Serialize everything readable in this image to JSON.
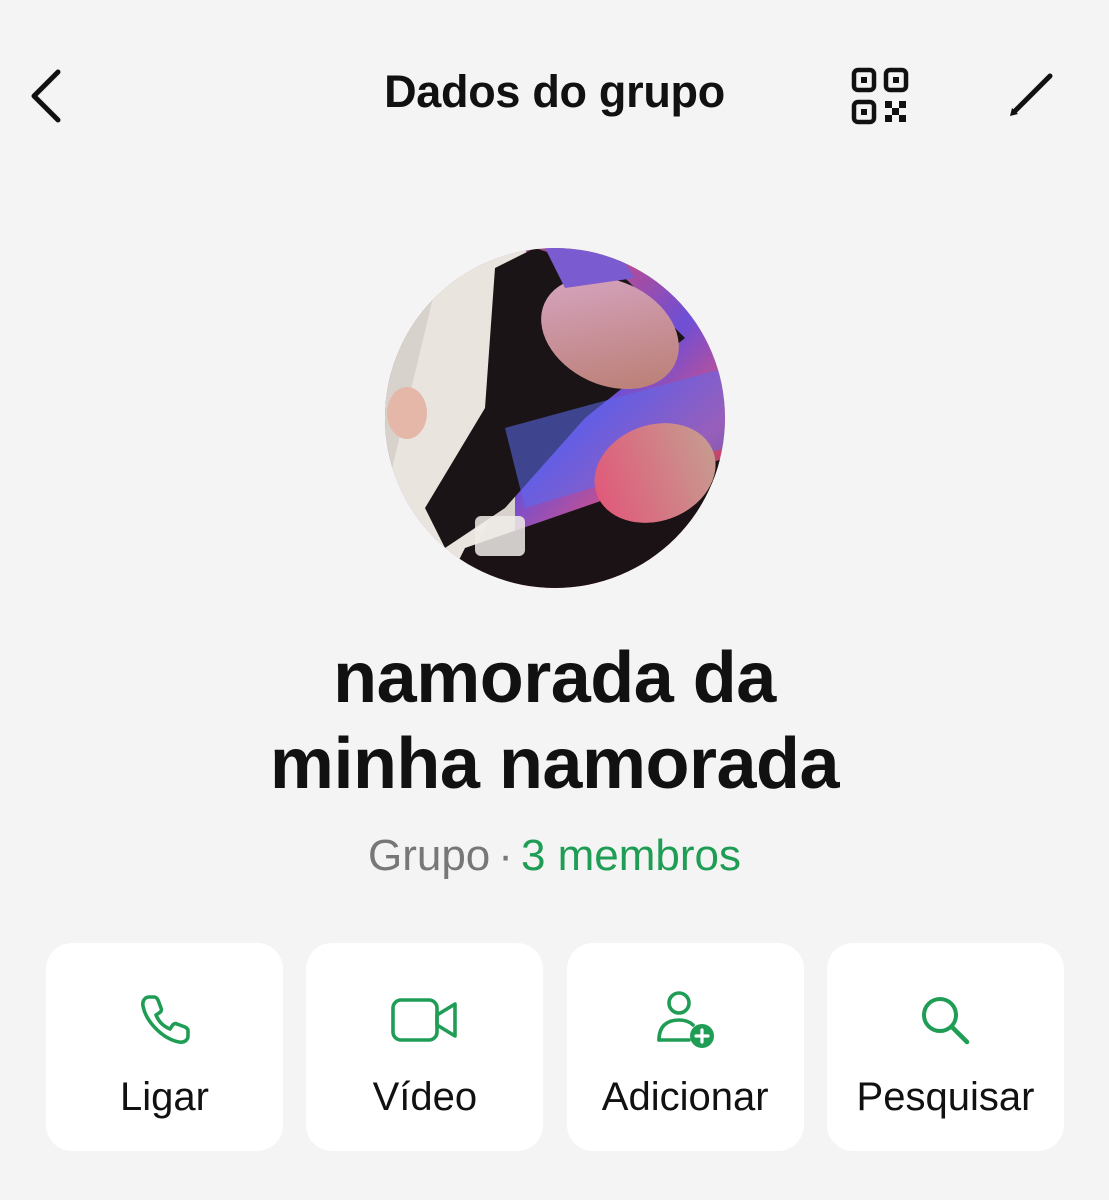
{
  "header": {
    "title": "Dados do grupo",
    "back_icon": "chevron-left-icon",
    "qr_icon": "qr-code-icon",
    "edit_icon": "pencil-icon"
  },
  "group": {
    "name_line1": "namorada da",
    "name_line2": "minha namorada",
    "kind": "Grupo",
    "separator": "·",
    "members": "3 membros"
  },
  "actions": [
    {
      "label": "Ligar",
      "icon": "phone-icon"
    },
    {
      "label": "Vídeo",
      "icon": "video-camera-icon"
    },
    {
      "label": "Adicionar",
      "icon": "add-person-icon"
    },
    {
      "label": "Pesquisar",
      "icon": "search-icon"
    }
  ],
  "colors": {
    "accent": "#1f9d55",
    "background": "#f4f4f4",
    "card": "#ffffff",
    "text": "#111111",
    "muted": "#777777"
  }
}
